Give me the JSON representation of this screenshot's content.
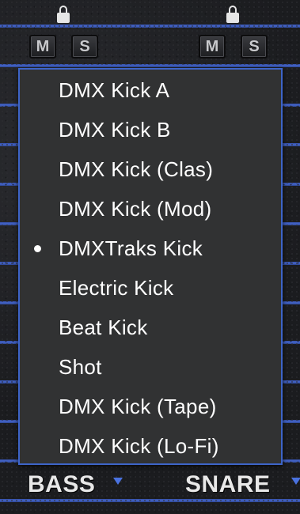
{
  "top_controls": {
    "left_group": {
      "mute_label": "M",
      "solo_label": "S"
    },
    "right_group": {
      "mute_label": "M",
      "solo_label": "S"
    }
  },
  "dropdown": {
    "selected": "DMXTraks Kick",
    "items": [
      {
        "label": "DMX Kick A",
        "selected": false
      },
      {
        "label": "DMX Kick B",
        "selected": false
      },
      {
        "label": "DMX Kick (Clas)",
        "selected": false
      },
      {
        "label": "DMX Kick (Mod)",
        "selected": false
      },
      {
        "label": "DMXTraks Kick",
        "selected": true
      },
      {
        "label": "Electric Kick",
        "selected": false
      },
      {
        "label": "Beat Kick",
        "selected": false
      },
      {
        "label": "Shot",
        "selected": false
      },
      {
        "label": "DMX Kick (Tape)",
        "selected": false
      },
      {
        "label": "DMX Kick (Lo-Fi)",
        "selected": false
      }
    ]
  },
  "bottom_labels": {
    "left": "BASS",
    "right": "SNARE"
  },
  "colors": {
    "accent": "#3d64c8",
    "menu_bg": "#313233",
    "panel_bg": "#1b1c1f"
  }
}
